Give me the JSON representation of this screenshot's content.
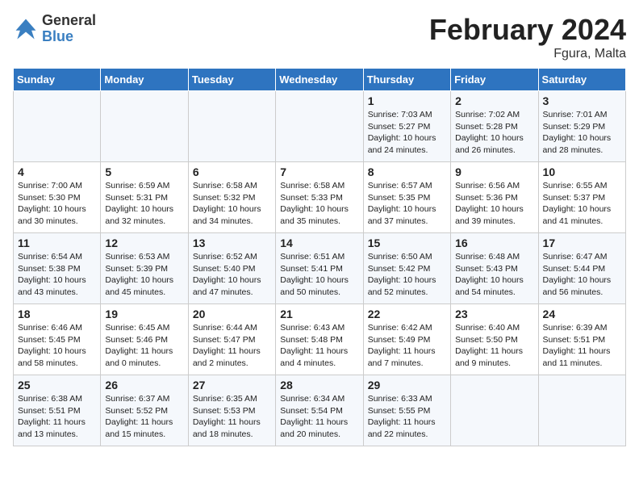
{
  "header": {
    "logo_general": "General",
    "logo_blue": "Blue",
    "title": "February 2024",
    "subtitle": "Fgura, Malta"
  },
  "days_of_week": [
    "Sunday",
    "Monday",
    "Tuesday",
    "Wednesday",
    "Thursday",
    "Friday",
    "Saturday"
  ],
  "weeks": [
    [
      {
        "num": "",
        "sunrise": "",
        "sunset": "",
        "daylight": ""
      },
      {
        "num": "",
        "sunrise": "",
        "sunset": "",
        "daylight": ""
      },
      {
        "num": "",
        "sunrise": "",
        "sunset": "",
        "daylight": ""
      },
      {
        "num": "",
        "sunrise": "",
        "sunset": "",
        "daylight": ""
      },
      {
        "num": "1",
        "sunrise": "Sunrise: 7:03 AM",
        "sunset": "Sunset: 5:27 PM",
        "daylight": "Daylight: 10 hours and 24 minutes."
      },
      {
        "num": "2",
        "sunrise": "Sunrise: 7:02 AM",
        "sunset": "Sunset: 5:28 PM",
        "daylight": "Daylight: 10 hours and 26 minutes."
      },
      {
        "num": "3",
        "sunrise": "Sunrise: 7:01 AM",
        "sunset": "Sunset: 5:29 PM",
        "daylight": "Daylight: 10 hours and 28 minutes."
      }
    ],
    [
      {
        "num": "4",
        "sunrise": "Sunrise: 7:00 AM",
        "sunset": "Sunset: 5:30 PM",
        "daylight": "Daylight: 10 hours and 30 minutes."
      },
      {
        "num": "5",
        "sunrise": "Sunrise: 6:59 AM",
        "sunset": "Sunset: 5:31 PM",
        "daylight": "Daylight: 10 hours and 32 minutes."
      },
      {
        "num": "6",
        "sunrise": "Sunrise: 6:58 AM",
        "sunset": "Sunset: 5:32 PM",
        "daylight": "Daylight: 10 hours and 34 minutes."
      },
      {
        "num": "7",
        "sunrise": "Sunrise: 6:58 AM",
        "sunset": "Sunset: 5:33 PM",
        "daylight": "Daylight: 10 hours and 35 minutes."
      },
      {
        "num": "8",
        "sunrise": "Sunrise: 6:57 AM",
        "sunset": "Sunset: 5:35 PM",
        "daylight": "Daylight: 10 hours and 37 minutes."
      },
      {
        "num": "9",
        "sunrise": "Sunrise: 6:56 AM",
        "sunset": "Sunset: 5:36 PM",
        "daylight": "Daylight: 10 hours and 39 minutes."
      },
      {
        "num": "10",
        "sunrise": "Sunrise: 6:55 AM",
        "sunset": "Sunset: 5:37 PM",
        "daylight": "Daylight: 10 hours and 41 minutes."
      }
    ],
    [
      {
        "num": "11",
        "sunrise": "Sunrise: 6:54 AM",
        "sunset": "Sunset: 5:38 PM",
        "daylight": "Daylight: 10 hours and 43 minutes."
      },
      {
        "num": "12",
        "sunrise": "Sunrise: 6:53 AM",
        "sunset": "Sunset: 5:39 PM",
        "daylight": "Daylight: 10 hours and 45 minutes."
      },
      {
        "num": "13",
        "sunrise": "Sunrise: 6:52 AM",
        "sunset": "Sunset: 5:40 PM",
        "daylight": "Daylight: 10 hours and 47 minutes."
      },
      {
        "num": "14",
        "sunrise": "Sunrise: 6:51 AM",
        "sunset": "Sunset: 5:41 PM",
        "daylight": "Daylight: 10 hours and 50 minutes."
      },
      {
        "num": "15",
        "sunrise": "Sunrise: 6:50 AM",
        "sunset": "Sunset: 5:42 PM",
        "daylight": "Daylight: 10 hours and 52 minutes."
      },
      {
        "num": "16",
        "sunrise": "Sunrise: 6:48 AM",
        "sunset": "Sunset: 5:43 PM",
        "daylight": "Daylight: 10 hours and 54 minutes."
      },
      {
        "num": "17",
        "sunrise": "Sunrise: 6:47 AM",
        "sunset": "Sunset: 5:44 PM",
        "daylight": "Daylight: 10 hours and 56 minutes."
      }
    ],
    [
      {
        "num": "18",
        "sunrise": "Sunrise: 6:46 AM",
        "sunset": "Sunset: 5:45 PM",
        "daylight": "Daylight: 10 hours and 58 minutes."
      },
      {
        "num": "19",
        "sunrise": "Sunrise: 6:45 AM",
        "sunset": "Sunset: 5:46 PM",
        "daylight": "Daylight: 11 hours and 0 minutes."
      },
      {
        "num": "20",
        "sunrise": "Sunrise: 6:44 AM",
        "sunset": "Sunset: 5:47 PM",
        "daylight": "Daylight: 11 hours and 2 minutes."
      },
      {
        "num": "21",
        "sunrise": "Sunrise: 6:43 AM",
        "sunset": "Sunset: 5:48 PM",
        "daylight": "Daylight: 11 hours and 4 minutes."
      },
      {
        "num": "22",
        "sunrise": "Sunrise: 6:42 AM",
        "sunset": "Sunset: 5:49 PM",
        "daylight": "Daylight: 11 hours and 7 minutes."
      },
      {
        "num": "23",
        "sunrise": "Sunrise: 6:40 AM",
        "sunset": "Sunset: 5:50 PM",
        "daylight": "Daylight: 11 hours and 9 minutes."
      },
      {
        "num": "24",
        "sunrise": "Sunrise: 6:39 AM",
        "sunset": "Sunset: 5:51 PM",
        "daylight": "Daylight: 11 hours and 11 minutes."
      }
    ],
    [
      {
        "num": "25",
        "sunrise": "Sunrise: 6:38 AM",
        "sunset": "Sunset: 5:51 PM",
        "daylight": "Daylight: 11 hours and 13 minutes."
      },
      {
        "num": "26",
        "sunrise": "Sunrise: 6:37 AM",
        "sunset": "Sunset: 5:52 PM",
        "daylight": "Daylight: 11 hours and 15 minutes."
      },
      {
        "num": "27",
        "sunrise": "Sunrise: 6:35 AM",
        "sunset": "Sunset: 5:53 PM",
        "daylight": "Daylight: 11 hours and 18 minutes."
      },
      {
        "num": "28",
        "sunrise": "Sunrise: 6:34 AM",
        "sunset": "Sunset: 5:54 PM",
        "daylight": "Daylight: 11 hours and 20 minutes."
      },
      {
        "num": "29",
        "sunrise": "Sunrise: 6:33 AM",
        "sunset": "Sunset: 5:55 PM",
        "daylight": "Daylight: 11 hours and 22 minutes."
      },
      {
        "num": "",
        "sunrise": "",
        "sunset": "",
        "daylight": ""
      },
      {
        "num": "",
        "sunrise": "",
        "sunset": "",
        "daylight": ""
      }
    ]
  ]
}
